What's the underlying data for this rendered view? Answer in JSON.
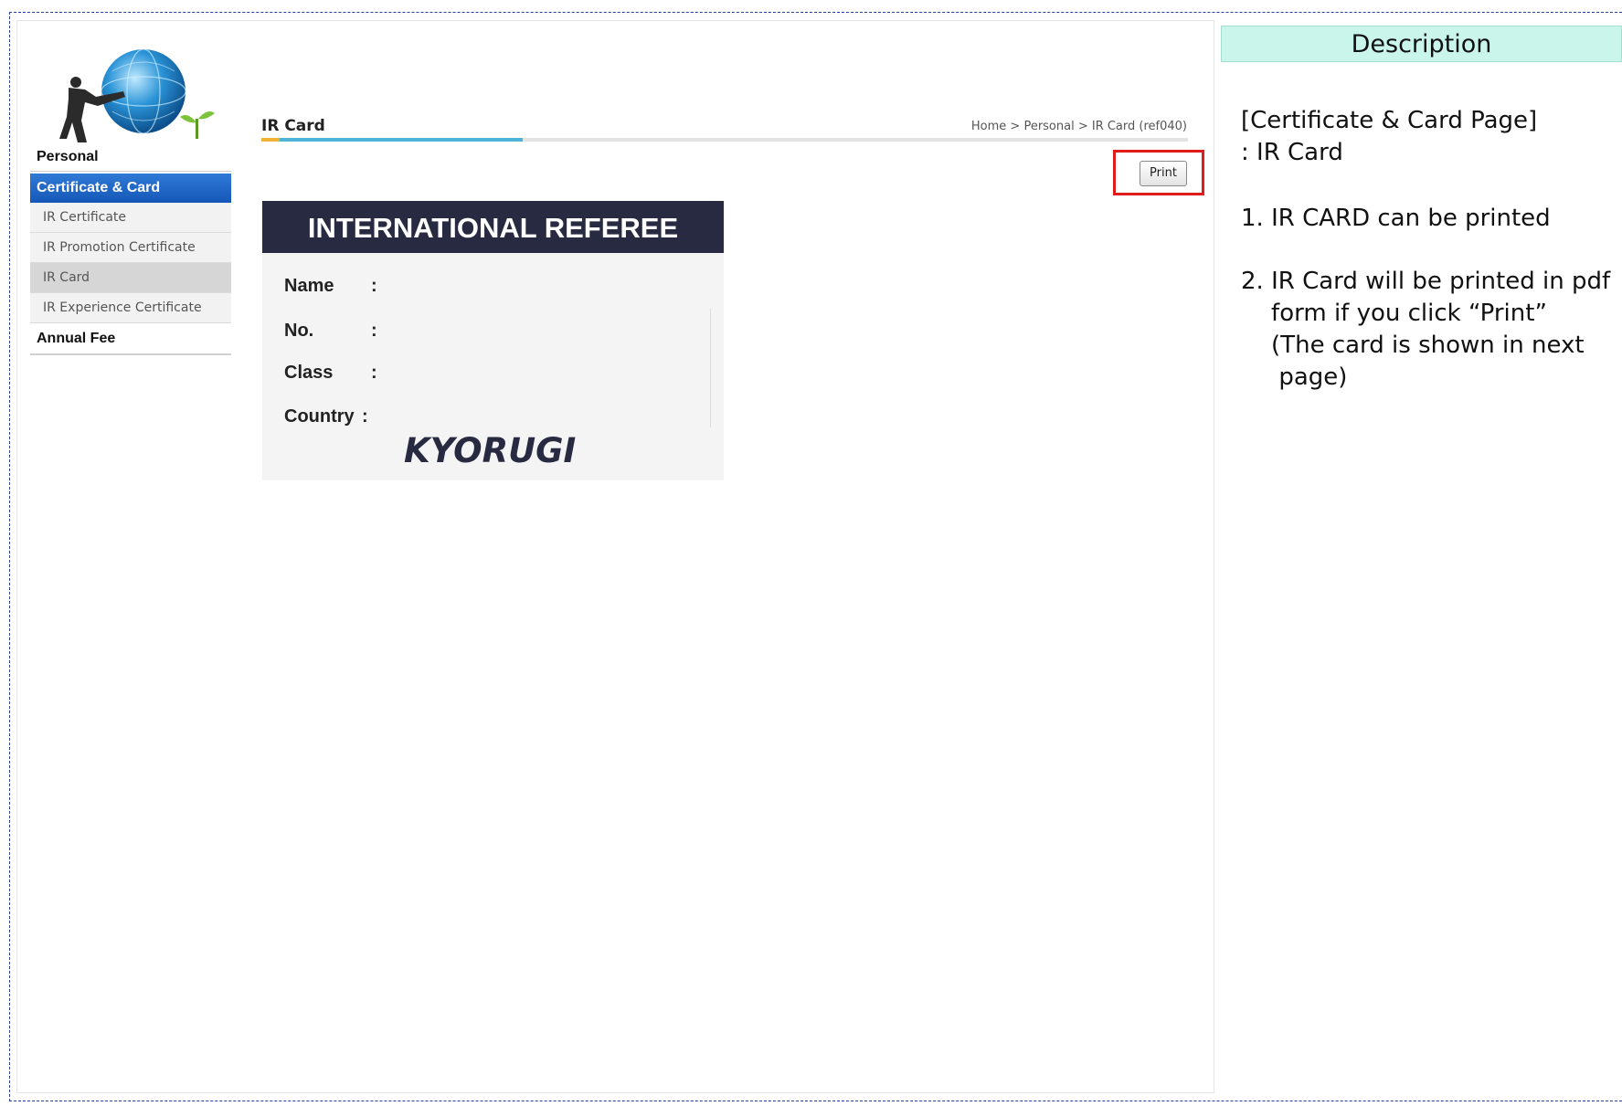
{
  "sidebar": {
    "personal": "Personal",
    "active_section": "Certificate & Card",
    "items": [
      {
        "label": "IR Certificate",
        "selected": false
      },
      {
        "label": "IR Promotion Certificate",
        "selected": false
      },
      {
        "label": "IR Card",
        "selected": true
      },
      {
        "label": "IR Experience Certificate",
        "selected": false
      }
    ],
    "annual_fee": "Annual Fee"
  },
  "header": {
    "title": "IR Card",
    "breadcrumb": "Home > Personal > IR Card (ref040)"
  },
  "print_label": "Print",
  "card": {
    "heading": "INTERNATIONAL REFEREE",
    "fields": [
      {
        "label": "Name",
        "sep": ":"
      },
      {
        "label": "No.",
        "sep": ":"
      },
      {
        "label": "Class",
        "sep": ":"
      },
      {
        "label": "Country",
        "sep": ":"
      }
    ],
    "event": "KYORUGI"
  },
  "description": {
    "heading": "Description",
    "line1": "[Certificate & Card Page]",
    "line2": ": IR Card",
    "line3": "1. IR CARD can be printed",
    "line4": "2. IR Card will be printed in pdf",
    "line5": "    form if you click “Print”",
    "line6": "    (The card is shown in next",
    "line7": "     page)"
  },
  "colors": {
    "accent_blue": "#1557b8",
    "highlight_red": "#e01b1b",
    "card_dark": "#272a40",
    "desc_header": "#c9f5ea"
  }
}
